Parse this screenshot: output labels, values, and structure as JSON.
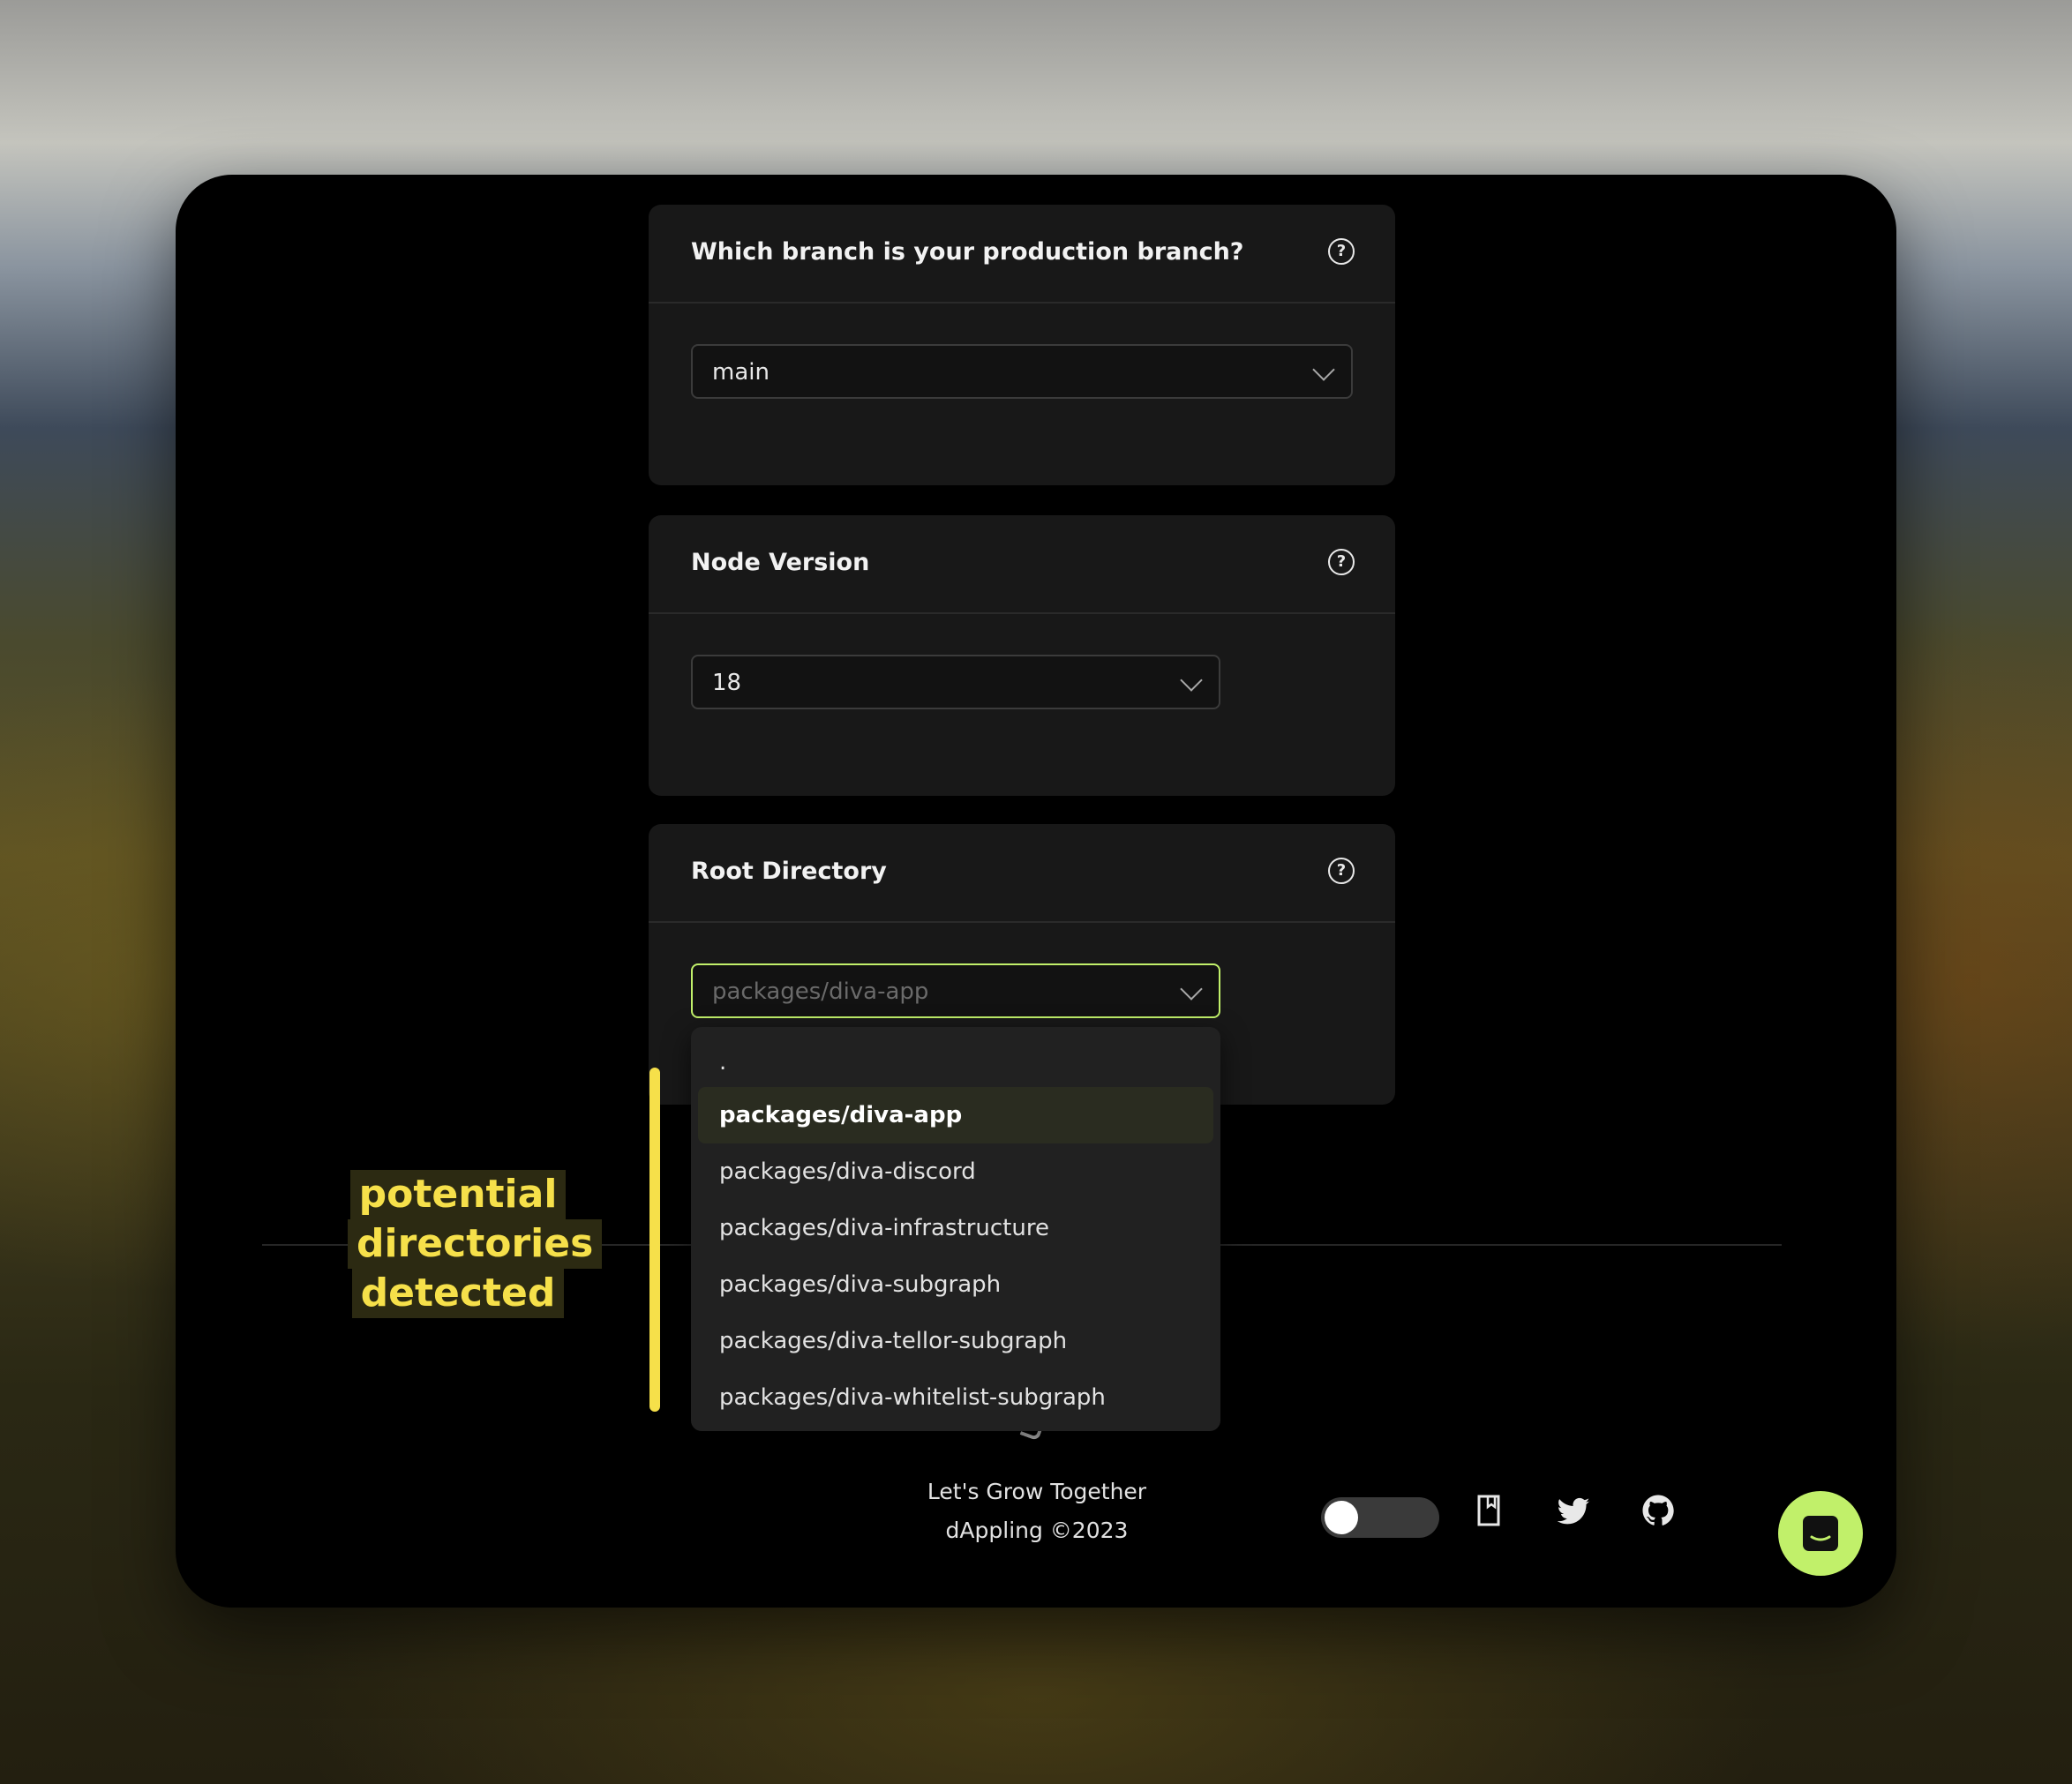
{
  "branch_card": {
    "title": "Which branch is your production branch?",
    "value": "main"
  },
  "node_card": {
    "title": "Node Version",
    "value": "18"
  },
  "root_card": {
    "title": "Root Directory",
    "placeholder": "packages/diva-app"
  },
  "dropdown": {
    "items": [
      {
        "label": "."
      },
      {
        "label": "packages/diva-app"
      },
      {
        "label": "packages/diva-discord"
      },
      {
        "label": "packages/diva-infrastructure"
      },
      {
        "label": "packages/diva-subgraph"
      },
      {
        "label": "packages/diva-tellor-subgraph"
      },
      {
        "label": "packages/diva-whitelist-subgraph"
      }
    ],
    "selected": "packages/diva-app"
  },
  "annotation": {
    "lines": [
      "potential",
      "directories",
      "detected"
    ],
    "color": "#f6e04a"
  },
  "footer": {
    "tagline": "Let's Grow Together",
    "copyright": "dAppling ©2023",
    "icons": [
      "theme-toggle",
      "docs-icon",
      "twitter-icon",
      "github-icon"
    ]
  },
  "chat": {
    "icon": "chat-icon",
    "color": "#c1f06a"
  },
  "colors": {
    "accent": "#c1f06a",
    "card_bg": "#181818"
  }
}
